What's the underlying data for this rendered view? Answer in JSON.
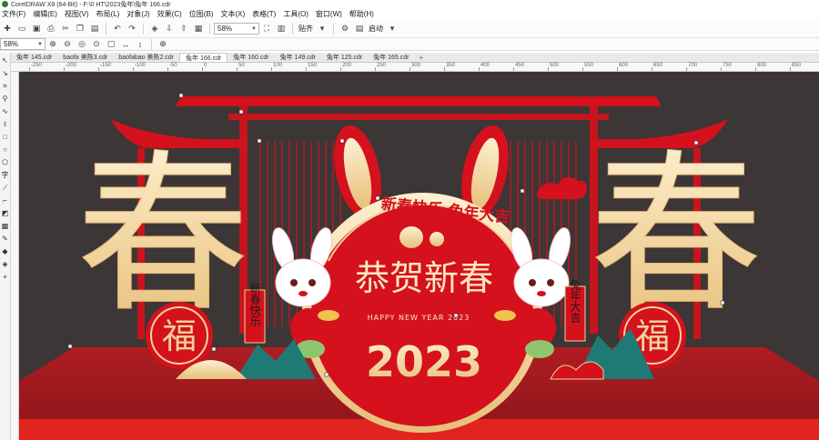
{
  "window": {
    "title": "CorelDRAW X8 (64-Bit) - F:\\0 HT\\2023兔年\\兔年 166.cdr"
  },
  "menu": {
    "items": [
      "文件(F)",
      "编辑(E)",
      "视图(V)",
      "布局(L)",
      "对象(J)",
      "效果(C)",
      "位图(B)",
      "文本(X)",
      "表格(T)",
      "工具(O)",
      "窗口(W)",
      "帮助(H)"
    ]
  },
  "toolbar": {
    "zoom_value": "58%",
    "snap_label": "贴齐",
    "launch_label": "启动"
  },
  "propertybar": {
    "zoom_value": "58%"
  },
  "tabs": [
    "兔年 145.cdr",
    "baofa 美陈3.cdr",
    "baofabao 美陈2.cdr",
    "兔年 166.cdr",
    "兔年 160.cdr",
    "兔年 149.cdr",
    "兔年 125.cdr",
    "兔年 165.cdr"
  ],
  "active_tab_index": 3,
  "ruler": {
    "labels": [
      "-250",
      "-200",
      "-150",
      "-100",
      "-50",
      "0",
      "50",
      "100",
      "150",
      "200",
      "250",
      "300",
      "350",
      "400",
      "450",
      "500",
      "550",
      "600",
      "650",
      "700",
      "750",
      "800",
      "850"
    ]
  },
  "artwork": {
    "big_char": "春",
    "fu_char": "福",
    "arch_text": "新春快乐  兔年大吉",
    "main_title": "恭贺新春",
    "subtitle": "HAPPY NEW YEAR 2023",
    "year": "2023",
    "scroll_left": "新春快乐",
    "scroll_right": "兔年大吉"
  },
  "colors": {
    "canvas_bg": "#3c3636",
    "red": "#d4111c",
    "dark_red": "#9e1a1e",
    "gold": "#f2d39a",
    "cream": "#fbe7c4"
  }
}
